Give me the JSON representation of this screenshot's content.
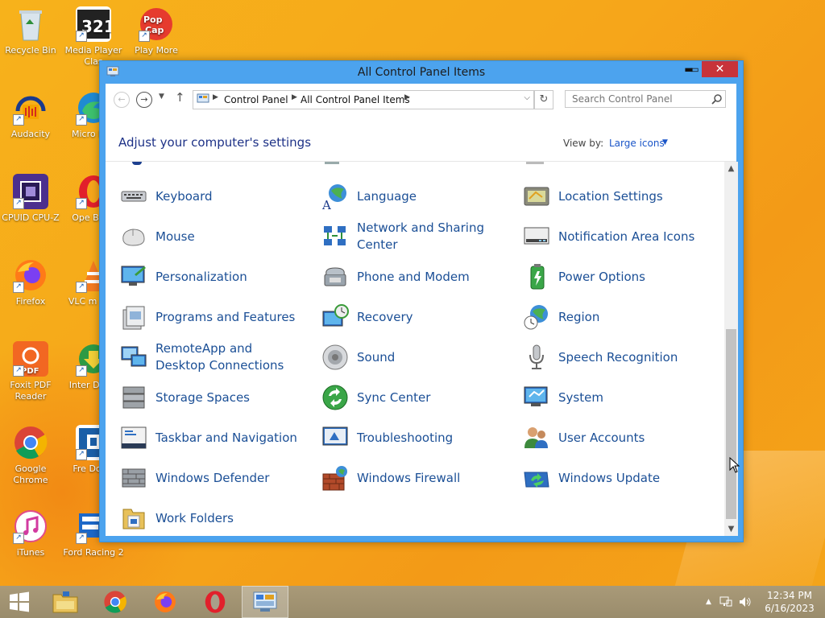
{
  "desktop": {
    "icons": [
      {
        "label": "Recycle Bin"
      },
      {
        "label": "Media Player Clas"
      },
      {
        "label": "Play More"
      },
      {
        "label": "Audacity"
      },
      {
        "label": "Micro Edg"
      },
      {
        "label": "CPUID CPU-Z"
      },
      {
        "label": "Ope Brow"
      },
      {
        "label": "Firefox"
      },
      {
        "label": "VLC m play"
      },
      {
        "label": "Foxit PDF Reader"
      },
      {
        "label": "Inter Down"
      },
      {
        "label": "Google Chrome"
      },
      {
        "label": "Fre Down"
      },
      {
        "label": "iTunes"
      },
      {
        "label": "Ford Racing 2"
      }
    ]
  },
  "window": {
    "title": "All Control Panel Items",
    "minimize": "▬",
    "maximize": "▭",
    "close": "✕"
  },
  "address": {
    "crumbs": [
      "Control Panel",
      "All Control Panel Items"
    ],
    "separator": "▶",
    "dropdown": "⌵",
    "refresh": "↻"
  },
  "search": {
    "placeholder": "Search Control Panel"
  },
  "header": {
    "title": "Adjust your computer's settings",
    "view_by_label": "View by:",
    "view_by_value": "Large icons",
    "view_by_arrow": "▼"
  },
  "items": [
    {
      "label": "Keyboard",
      "icon": "keyboard-icon"
    },
    {
      "label": "Language",
      "icon": "language-icon"
    },
    {
      "label": "Location Settings",
      "icon": "location-icon"
    },
    {
      "label": "Mouse",
      "icon": "mouse-icon"
    },
    {
      "label": "Network and Sharing Center",
      "icon": "network-icon"
    },
    {
      "label": "Notification Area Icons",
      "icon": "notification-icon"
    },
    {
      "label": "Personalization",
      "icon": "personalization-icon"
    },
    {
      "label": "Phone and Modem",
      "icon": "phone-icon"
    },
    {
      "label": "Power Options",
      "icon": "power-icon"
    },
    {
      "label": "Programs and Features",
      "icon": "programs-icon"
    },
    {
      "label": "Recovery",
      "icon": "recovery-icon"
    },
    {
      "label": "Region",
      "icon": "region-icon"
    },
    {
      "label": "RemoteApp and Desktop Connections",
      "icon": "remoteapp-icon"
    },
    {
      "label": "Sound",
      "icon": "sound-icon"
    },
    {
      "label": "Speech Recognition",
      "icon": "microphone-icon"
    },
    {
      "label": "Storage Spaces",
      "icon": "storage-icon"
    },
    {
      "label": "Sync Center",
      "icon": "sync-icon"
    },
    {
      "label": "System",
      "icon": "system-icon"
    },
    {
      "label": "Taskbar and Navigation",
      "icon": "taskbar-icon"
    },
    {
      "label": "Troubleshooting",
      "icon": "troubleshooting-icon"
    },
    {
      "label": "User Accounts",
      "icon": "users-icon"
    },
    {
      "label": "Windows Defender",
      "icon": "defender-icon"
    },
    {
      "label": "Windows Firewall",
      "icon": "firewall-icon"
    },
    {
      "label": "Windows Update",
      "icon": "update-icon"
    },
    {
      "label": "Work Folders",
      "icon": "folder-icon"
    }
  ],
  "scrollbar": {
    "up": "▲",
    "down": "▼",
    "position": 0.72
  },
  "taskbar": {
    "time": "12:34 PM",
    "date": "6/16/2023"
  }
}
